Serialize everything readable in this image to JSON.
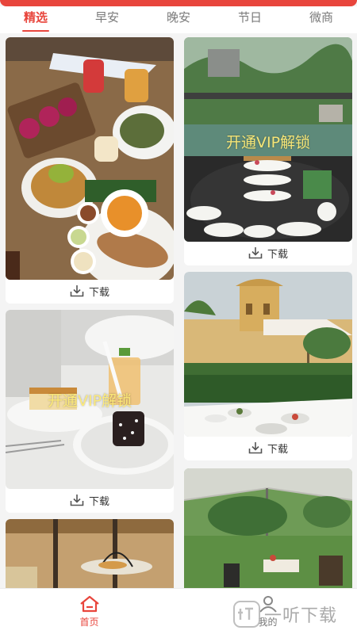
{
  "tabs": [
    {
      "label": "精选"
    },
    {
      "label": "早安"
    },
    {
      "label": "晚安"
    },
    {
      "label": "节日"
    },
    {
      "label": "微商"
    }
  ],
  "cards": [
    {
      "download_label": "下载"
    },
    {
      "download_label": "下载",
      "vip_text": "开通VIP解锁"
    },
    {
      "download_label": "下载",
      "vip_text": "开通VIP解锁"
    },
    {
      "download_label": "下载"
    }
  ],
  "nav": {
    "home_label": "首页",
    "mine_label": "我的"
  },
  "watermark": "一听下载",
  "colors": {
    "accent": "#e8453c"
  }
}
